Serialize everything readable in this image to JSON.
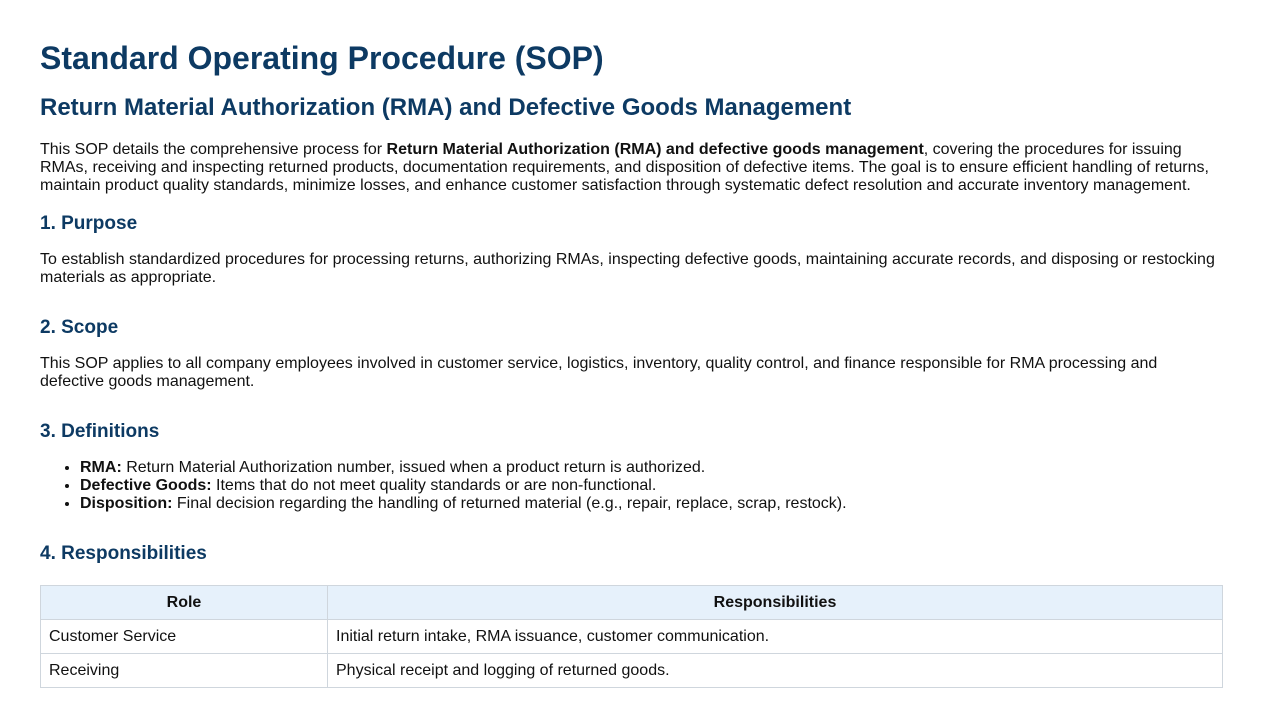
{
  "title": "Standard Operating Procedure (SOP)",
  "subtitle": "Return Material Authorization (RMA) and Defective Goods Management",
  "intro": {
    "prefix": "This SOP details the comprehensive process for ",
    "bold": "Return Material Authorization (RMA) and defective goods management",
    "suffix": ", covering the procedures for issuing RMAs, receiving and inspecting returned products, documentation requirements, and disposition of defective items. The goal is to ensure efficient handling of returns, maintain product quality standards, minimize losses, and enhance customer satisfaction through systematic defect resolution and accurate inventory management."
  },
  "sections": {
    "purpose": {
      "heading": "1. Purpose",
      "text": "To establish standardized procedures for processing returns, authorizing RMAs, inspecting defective goods, maintaining accurate records, and disposing or restocking materials as appropriate."
    },
    "scope": {
      "heading": "2. Scope",
      "text": "This SOP applies to all company employees involved in customer service, logistics, inventory, quality control, and finance responsible for RMA processing and defective goods management."
    },
    "definitions": {
      "heading": "3. Definitions",
      "items": [
        {
          "term": "RMA:",
          "definition": " Return Material Authorization number, issued when a product return is authorized."
        },
        {
          "term": "Defective Goods:",
          "definition": " Items that do not meet quality standards or are non-functional."
        },
        {
          "term": "Disposition:",
          "definition": " Final decision regarding the handling of returned material (e.g., repair, replace, scrap, restock)."
        }
      ]
    },
    "responsibilities": {
      "heading": "4. Responsibilities",
      "columns": [
        "Role",
        "Responsibilities"
      ],
      "rows": [
        {
          "role": "Customer Service",
          "responsibilities": "Initial return intake, RMA issuance, customer communication."
        },
        {
          "role": "Receiving",
          "responsibilities": "Physical receipt and logging of returned goods."
        }
      ]
    }
  }
}
